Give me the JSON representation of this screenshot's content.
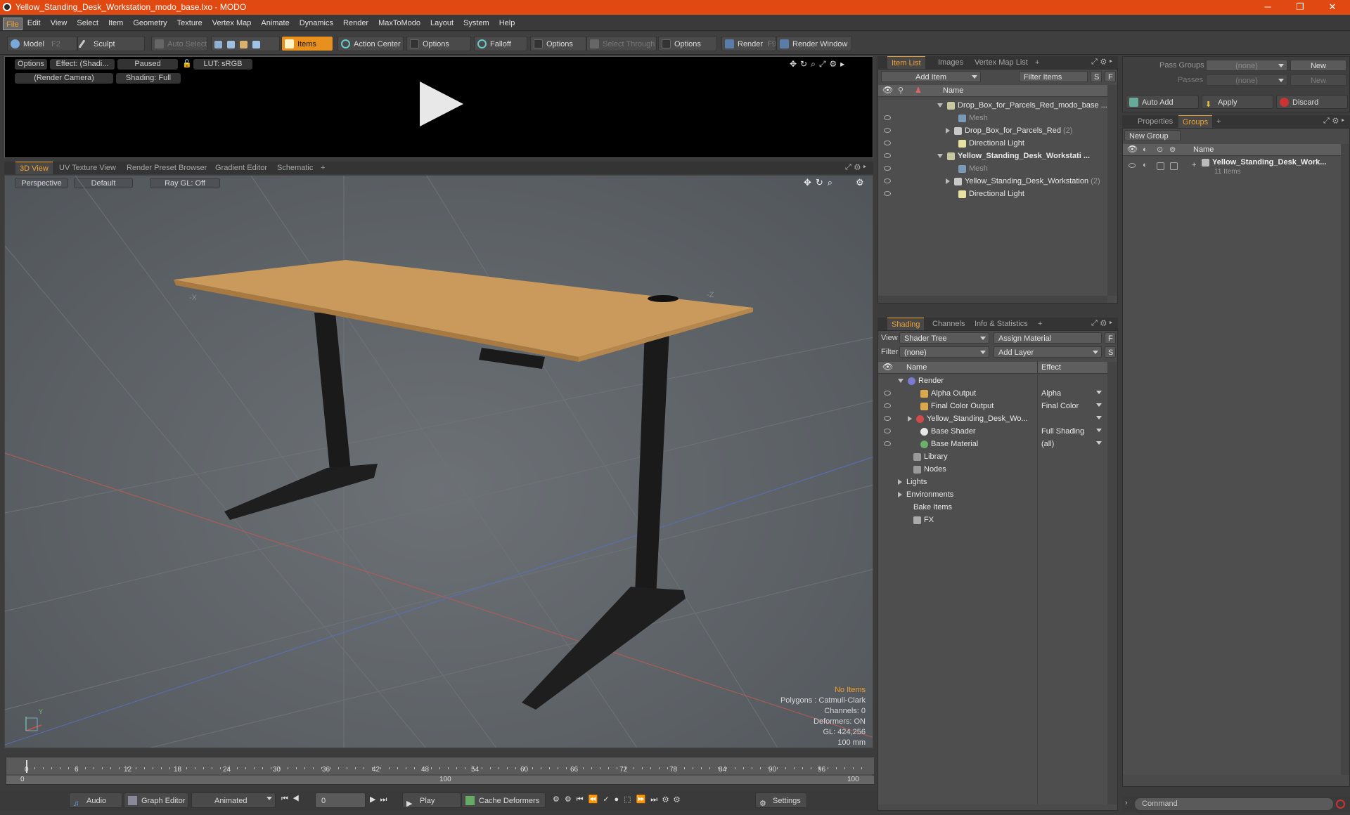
{
  "window": {
    "title": "Yellow_Standing_Desk_Workstation_modo_base.lxo - MODO",
    "minimize": "─",
    "restore": "❐",
    "close": "✕"
  },
  "menu": [
    "File",
    "Edit",
    "View",
    "Select",
    "Item",
    "Geometry",
    "Texture",
    "Vertex Map",
    "Animate",
    "Dynamics",
    "Render",
    "MaxToModo",
    "Layout",
    "System",
    "Help"
  ],
  "toolbar": {
    "model": "Model",
    "model_key": "F2",
    "sculpt": "Sculpt",
    "auto_select": "Auto Select",
    "items": "Items",
    "action_center": "Action Center",
    "options1": "Options",
    "falloff": "Falloff",
    "options2": "Options",
    "select_through": "Select Through",
    "options3": "Options",
    "render": "Render",
    "render_key": "F9",
    "render_window": "Render Window"
  },
  "preview": {
    "options": "Options",
    "effect": "Effect: (Shadi...",
    "paused": "Paused",
    "lut": "LUT: sRGB",
    "camera": "(Render Camera)",
    "shading": "Shading: Full"
  },
  "viewport_tabs": [
    "3D View",
    "UV Texture View",
    "Render Preset Browser",
    "Gradient Editor",
    "Schematic",
    "+"
  ],
  "viewport": {
    "perspective": "Perspective",
    "default": "Default",
    "raygl": "Ray GL: Off",
    "axis_x": "-X",
    "axis_z": "-Z",
    "axis_y": "Y"
  },
  "viewport_info": {
    "no_items": "No Items",
    "polygons": "Polygons : Catmull-Clark",
    "channels": "Channels: 0",
    "deformers": "Deformers: ON",
    "gl": "GL: 424,256",
    "scale": "100 mm"
  },
  "timeline": {
    "ticks": [
      "0",
      "6",
      "12",
      "18",
      "24",
      "30",
      "36",
      "42",
      "48",
      "54",
      "60",
      "66",
      "72",
      "78",
      "84",
      "90",
      "96"
    ],
    "range_start": "0",
    "range_mid": "100",
    "range_end": "100"
  },
  "bottom": {
    "audio": "Audio",
    "graph_editor": "Graph Editor",
    "animated": "Animated",
    "frame": "0",
    "play": "Play",
    "cache_deformers": "Cache Deformers",
    "settings": "Settings"
  },
  "itemlist": {
    "tabs": [
      "Item List",
      "Images",
      "Vertex Map List",
      "+"
    ],
    "add_item": "Add Item",
    "filter_items": "Filter Items",
    "s": "S",
    "f": "F",
    "col_name": "Name",
    "rows": [
      {
        "label": "Drop_Box_for_Parcels_Red_modo_base ...",
        "indent": 0,
        "bold": false,
        "count": ""
      },
      {
        "label": "Mesh",
        "indent": 1,
        "bold": false,
        "count": "",
        "dim": true
      },
      {
        "label": "Drop_Box_for_Parcels_Red",
        "indent": 1,
        "bold": false,
        "count": "(2)"
      },
      {
        "label": "Directional Light",
        "indent": 1,
        "bold": false,
        "count": ""
      },
      {
        "label": "Yellow_Standing_Desk_Workstati ...",
        "indent": 0,
        "bold": true,
        "count": ""
      },
      {
        "label": "Mesh",
        "indent": 1,
        "bold": false,
        "count": "",
        "dim": true
      },
      {
        "label": "Yellow_Standing_Desk_Workstation",
        "indent": 1,
        "bold": false,
        "count": "(2)"
      },
      {
        "label": "Directional Light",
        "indent": 1,
        "bold": false,
        "count": ""
      }
    ]
  },
  "shading": {
    "tabs": [
      "Shading",
      "Channels",
      "Info & Statistics",
      "+"
    ],
    "view_label": "View",
    "view_value": "Shader Tree",
    "assign_material": "Assign Material",
    "f": "F",
    "filter_label": "Filter",
    "filter_value": "(none)",
    "add_layer": "Add Layer",
    "s": "S",
    "col_name": "Name",
    "col_effect": "Effect",
    "rows": [
      {
        "label": "Render",
        "effect": ""
      },
      {
        "label": "Alpha Output",
        "effect": "Alpha"
      },
      {
        "label": "Final Color Output",
        "effect": "Final Color"
      },
      {
        "label": "Yellow_Standing_Desk_Wo...",
        "effect": ""
      },
      {
        "label": "Base Shader",
        "effect": "Full Shading"
      },
      {
        "label": "Base Material",
        "effect": "(all)"
      },
      {
        "label": "Library",
        "effect": ""
      },
      {
        "label": "Nodes",
        "effect": ""
      },
      {
        "label": "Lights",
        "effect": ""
      },
      {
        "label": "Environments",
        "effect": ""
      },
      {
        "label": "Bake Items",
        "effect": ""
      },
      {
        "label": "FX",
        "effect": ""
      }
    ]
  },
  "right": {
    "pass_groups": "Pass Groups",
    "passes": "Passes",
    "none1": "(none)",
    "none2": "(none)",
    "new1": "New",
    "new2": "New",
    "auto_add": "Auto Add",
    "apply": "Apply",
    "discard": "Discard",
    "tabs": [
      "Properties",
      "Groups",
      "+"
    ],
    "new_group": "New Group",
    "col_name": "Name",
    "group_name": "Yellow_Standing_Desk_Work...",
    "group_count": "11 Items",
    "command_placeholder": "Command"
  }
}
